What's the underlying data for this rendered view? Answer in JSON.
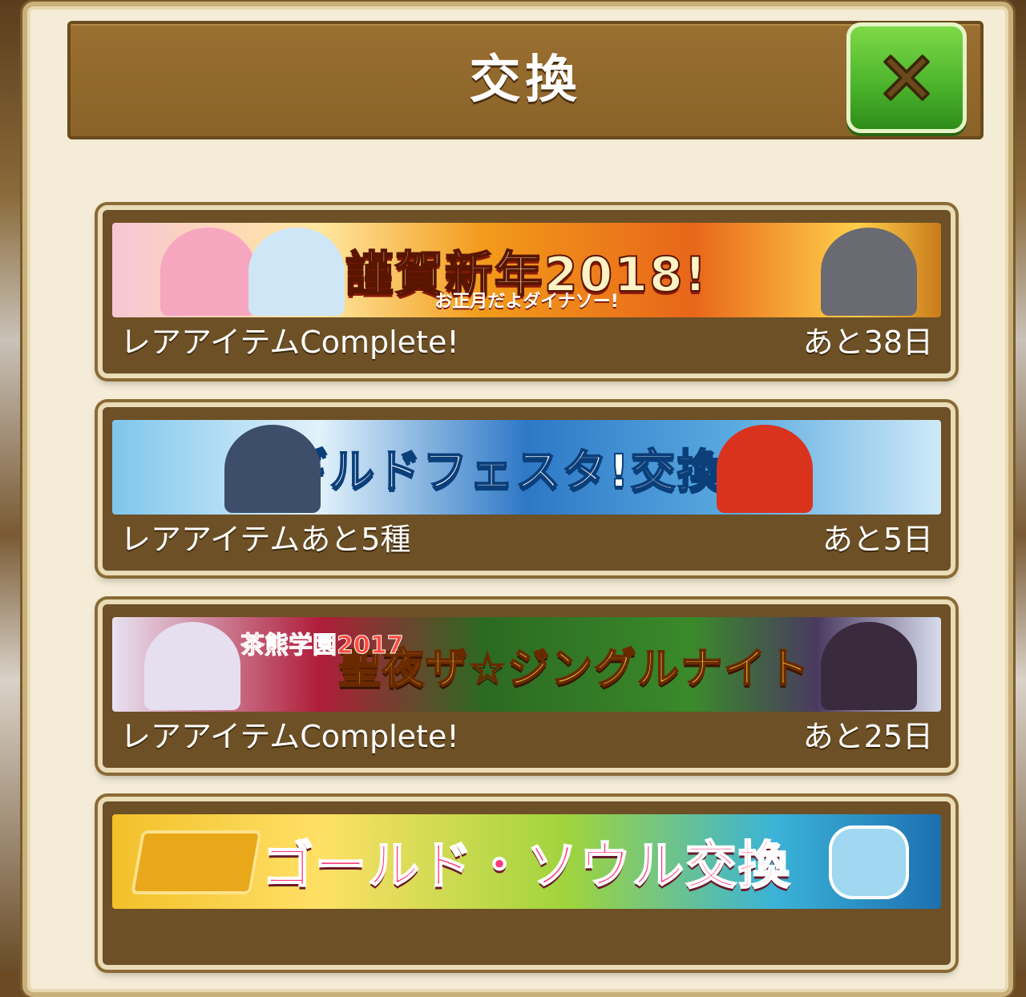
{
  "dialog": {
    "title": "交換",
    "close_icon": "close-icon"
  },
  "cards": [
    {
      "banner_title": "謹賀新年2018!",
      "banner_subtitle": "お正月だよダイナソー!",
      "left_text": "レアアイテムComplete!",
      "right_text": "あと38日"
    },
    {
      "banner_title": "ギルドフェスタ!交換所",
      "left_text": "レアアイテムあと5種",
      "right_text": "あと5日"
    },
    {
      "banner_title": "聖夜ザ☆ジングルナイト",
      "banner_badge": "茶熊学園2017",
      "left_text": "レアアイテムComplete!",
      "right_text": "あと25日"
    },
    {
      "banner_title": "ゴールド・ソウル交換",
      "left_text": "",
      "right_text": ""
    }
  ],
  "colors": {
    "header": "#8a6228",
    "panel": "#f4ecd6",
    "close_button": "#49b22a",
    "card_footer": "#6d5026"
  }
}
